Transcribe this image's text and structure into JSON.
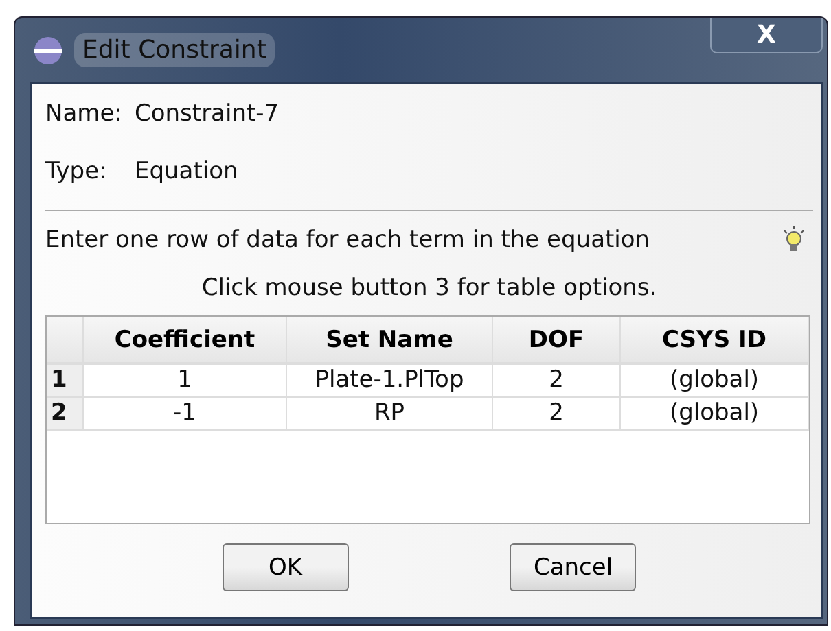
{
  "window": {
    "title": "Edit Constraint",
    "close": "X"
  },
  "fields": [
    {
      "label": "Name:",
      "value": "Constraint-7"
    },
    {
      "label": "Type:",
      "value": "Equation"
    }
  ],
  "instruction": "Enter one row of data for each term in the equation",
  "hint": "Click mouse button 3 for table options.",
  "table": {
    "columns": [
      "Coefficient",
      "Set Name",
      "DOF",
      "CSYS ID"
    ],
    "rows": [
      {
        "number": "1",
        "cells": [
          "1",
          "Plate-1.PlTop",
          "2",
          "(global)"
        ]
      },
      {
        "number": "2",
        "cells": [
          "-1",
          "RP",
          "2",
          "(global)"
        ]
      }
    ]
  },
  "buttons": [
    "OK",
    "Cancel"
  ]
}
